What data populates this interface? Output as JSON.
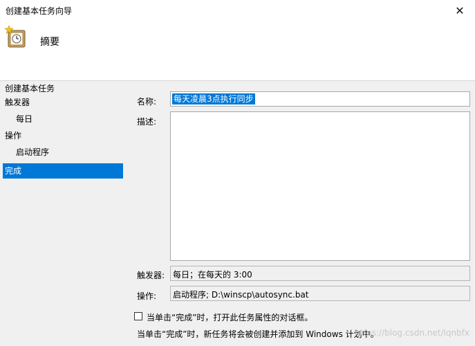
{
  "window": {
    "title": "创建基本任务向导",
    "close_glyph": "✕"
  },
  "header": {
    "title": "摘要"
  },
  "sidebar": {
    "items": [
      {
        "label": "创建基本任务"
      },
      {
        "label": "触发器"
      },
      {
        "label": "每日"
      },
      {
        "label": "操作"
      },
      {
        "label": "启动程序"
      },
      {
        "label": "完成"
      }
    ]
  },
  "form": {
    "name_label": "名称:",
    "name_value": "每天凌晨3点执行同步",
    "description_label": "描述:",
    "description_value": "",
    "trigger_label": "触发器:",
    "trigger_value": "每日；在每天的 3:00",
    "action_label": "操作:",
    "action_value": "启动程序; D:\\winscp\\autosync.bat"
  },
  "footer": {
    "checkbox_label": "当单击“完成”时，打开此任务属性的对话框。",
    "checkbox_checked": false,
    "note": "当单击“完成”时，新任务将会被创建并添加到 Windows 计划中。",
    "watermark": "https://blog.csdn.net/lqnbfx"
  },
  "colors": {
    "accent": "#0078d7",
    "background": "#f0f0f0"
  }
}
